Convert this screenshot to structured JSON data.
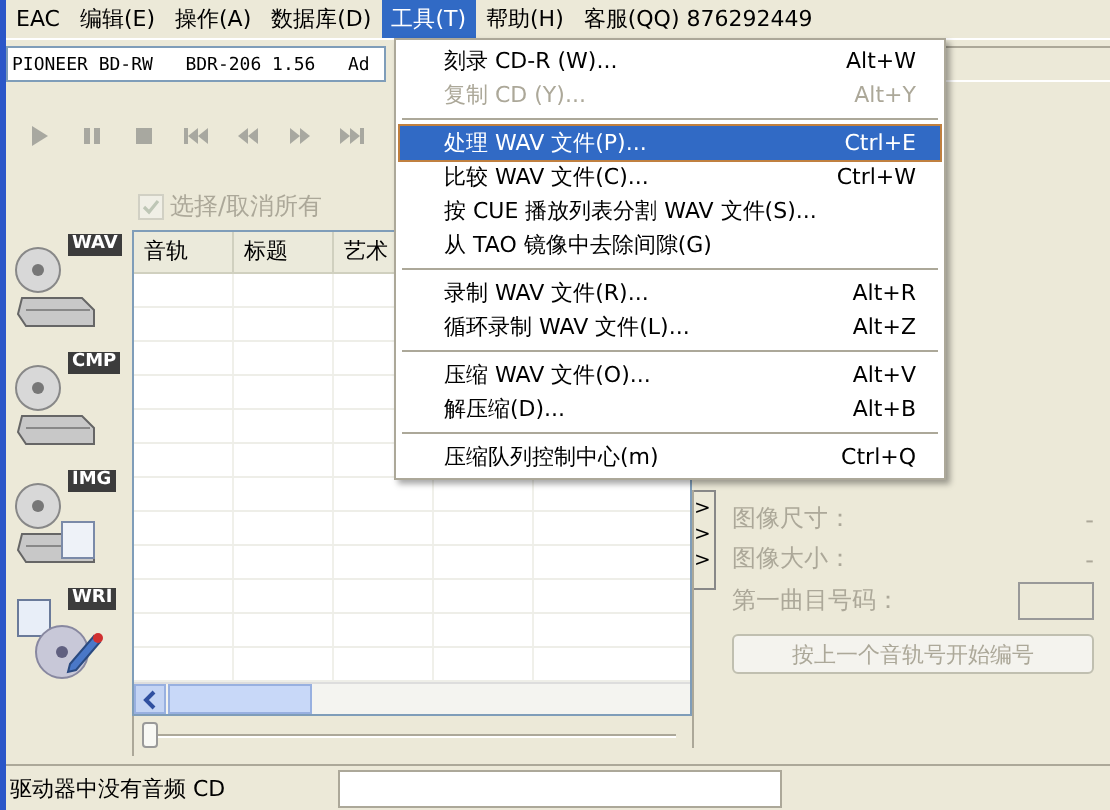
{
  "menubar": [
    {
      "label": "EAC",
      "selected": false
    },
    {
      "label": "编辑(E)",
      "selected": false
    },
    {
      "label": "操作(A)",
      "selected": false
    },
    {
      "label": "数据库(D)",
      "selected": false
    },
    {
      "label": "工具(T)",
      "selected": true
    },
    {
      "label": "帮助(H)",
      "selected": false
    },
    {
      "label": "客服(QQ) 876292449",
      "selected": false
    }
  ],
  "drive": {
    "value": "PIONEER BD-RW   BDR-206 1.56   Ad"
  },
  "select_all": {
    "label": "选择/取消所有",
    "checked": true,
    "disabled": true
  },
  "side_buttons": [
    {
      "label": "WAV"
    },
    {
      "label": "CMP"
    },
    {
      "label": "IMG"
    },
    {
      "label": "WRI"
    }
  ],
  "table": {
    "columns": [
      "音轨",
      "标题",
      "艺术"
    ]
  },
  "image_panel": {
    "fields": [
      {
        "label": "图像尺寸：",
        "value": "-"
      },
      {
        "label": "图像大小：",
        "value": "-"
      }
    ],
    "first_track_label": "第一曲目号码：",
    "button": "按上一个音轨号开始编号",
    "arrows": [
      ">",
      ">",
      ">"
    ]
  },
  "position_slider": {
    "level": 0
  },
  "status_bar": {
    "text": "驱动器中没有音频 CD"
  },
  "menu": [
    {
      "kind": "item",
      "label": "刻录 CD-R (W)...",
      "shortcut": "Alt+W",
      "disabled": false,
      "selected": false
    },
    {
      "kind": "item",
      "label": "复制 CD (Y)...",
      "shortcut": "Alt+Y",
      "disabled": true,
      "selected": false
    },
    {
      "kind": "separator"
    },
    {
      "kind": "item",
      "label": "处理 WAV 文件(P)...",
      "shortcut": "Ctrl+E",
      "disabled": false,
      "selected": true
    },
    {
      "kind": "item",
      "label": "比较 WAV 文件(C)...",
      "shortcut": "Ctrl+W",
      "disabled": false,
      "selected": false
    },
    {
      "kind": "item",
      "label": "按 CUE 播放列表分割 WAV 文件(S)...",
      "disabled": false,
      "selected": false
    },
    {
      "kind": "item",
      "label": "从 TAO 镜像中去除间隙(G)",
      "disabled": false,
      "selected": false
    },
    {
      "kind": "separator"
    },
    {
      "kind": "item",
      "label": "录制 WAV 文件(R)...",
      "shortcut": "Alt+R",
      "disabled": false,
      "selected": false
    },
    {
      "kind": "item",
      "label": "循环录制 WAV 文件(L)...",
      "shortcut": "Alt+Z",
      "disabled": false,
      "selected": false
    },
    {
      "kind": "separator"
    },
    {
      "kind": "item",
      "label": "压缩 WAV 文件(O)...",
      "shortcut": "Alt+V",
      "disabled": false,
      "selected": false
    },
    {
      "kind": "item",
      "label": "解压缩(D)...",
      "shortcut": "Alt+B",
      "disabled": false,
      "selected": false
    },
    {
      "kind": "separator"
    },
    {
      "kind": "item",
      "label": "压缩队列控制中心(m)",
      "shortcut": "Ctrl+Q",
      "disabled": false,
      "selected": false
    }
  ]
}
